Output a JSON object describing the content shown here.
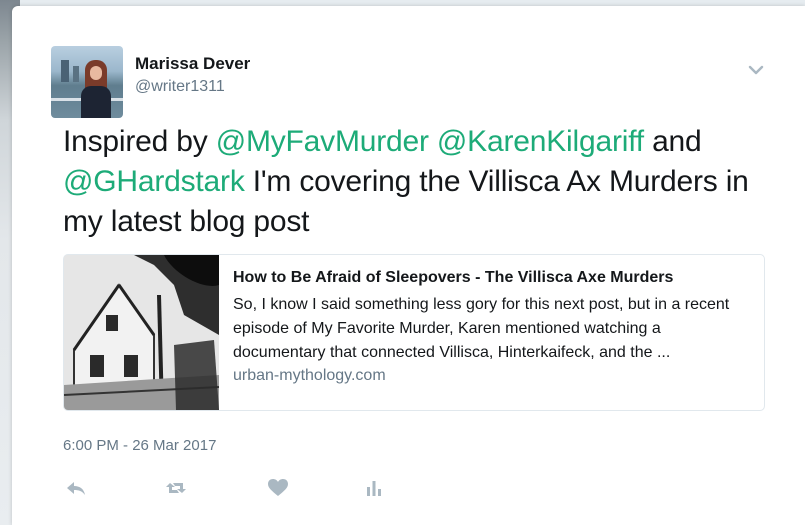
{
  "author": {
    "name": "Marissa Dever",
    "handle": "@writer1311",
    "avatar_icon": "profile-photo"
  },
  "tweet": {
    "segments": [
      {
        "text": "Inspired by ",
        "type": "text"
      },
      {
        "text": "@MyFavMurder",
        "type": "mention"
      },
      {
        "text": " ",
        "type": "text"
      },
      {
        "text": "@KarenKilgariff",
        "type": "mention"
      },
      {
        "text": " and ",
        "type": "text"
      },
      {
        "text": "@GHardstark",
        "type": "mention"
      },
      {
        "text": " I'm covering the Villisca Ax Murders in my latest blog post",
        "type": "text"
      }
    ]
  },
  "link_card": {
    "title": "How to Be Afraid of Sleepovers - The Villisca Axe Murders",
    "description": "So, I know I said something less gory for this next post, but in a recent episode of My Favorite Murder, Karen mentioned watching a documentary that connected Villisca, Hinterkaifeck, and the ...",
    "domain": "urban-mythology.com"
  },
  "timestamp": "6:00 PM - 26 Mar 2017",
  "actions": {
    "reply_icon": "reply-icon",
    "retweet_icon": "retweet-icon",
    "like_icon": "heart-icon",
    "analytics_icon": "analytics-icon"
  },
  "colors": {
    "mention": "#1dab78",
    "text": "#14171a",
    "secondary": "#657786",
    "icon": "#aab8c2"
  }
}
